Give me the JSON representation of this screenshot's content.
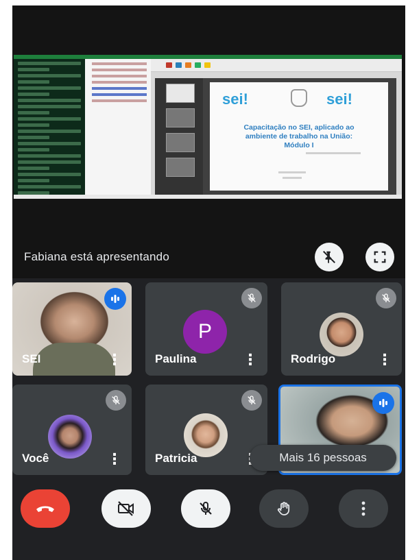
{
  "presentation": {
    "presenter_text": "Fabiana está apresentando",
    "slide": {
      "logo_left": "sei!",
      "logo_right": "sei!",
      "title_line1": "Capacitação no SEI, aplicado ao",
      "title_line2": "ambiente de trabalho na União:",
      "title_line3": "Módulo I"
    }
  },
  "participants": [
    {
      "name": "SEI",
      "type": "video",
      "audio": "speaking"
    },
    {
      "name": "Paulina",
      "type": "letter-avatar",
      "initial": "P",
      "audio": "muted"
    },
    {
      "name": "Rodrigo",
      "type": "photo-avatar",
      "audio": "muted"
    },
    {
      "name": "Você",
      "type": "photo-avatar",
      "audio": "muted"
    },
    {
      "name": "Patricia",
      "type": "photo-avatar",
      "audio": "muted"
    },
    {
      "name": "",
      "type": "video",
      "audio": "speaking"
    }
  ],
  "more_people": "Mais 16 pessoas",
  "menu_glyph": "⋮",
  "icons": {
    "unpin": "pin-off-icon",
    "fullscreen": "fullscreen-icon",
    "muted": "mic-off-icon",
    "speaking": "audio-level-icon",
    "end_call": "phone-hangup-icon",
    "camera": "videocam-off-icon",
    "mic": "mic-off-icon",
    "raise_hand": "hand-icon",
    "more": "more-vertical-icon"
  },
  "colors": {
    "end_call": "#ea4335",
    "active_speaker": "#1a73e8",
    "avatar_purple": "#8e24aa",
    "tile": "#3c4043"
  }
}
